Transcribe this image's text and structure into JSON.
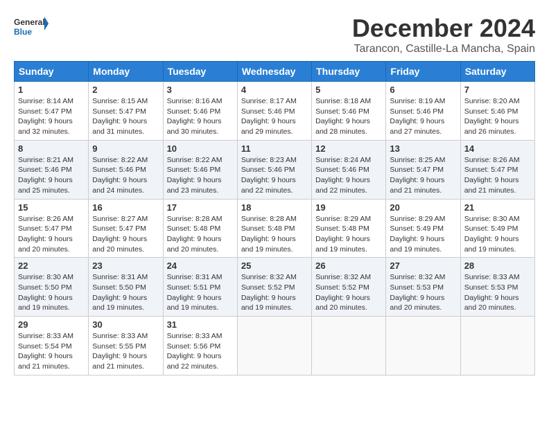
{
  "logo": {
    "general": "General",
    "blue": "Blue"
  },
  "header": {
    "month": "December 2024",
    "location": "Tarancon, Castille-La Mancha, Spain"
  },
  "weekdays": [
    "Sunday",
    "Monday",
    "Tuesday",
    "Wednesday",
    "Thursday",
    "Friday",
    "Saturday"
  ],
  "weeks": [
    [
      {
        "day": "1",
        "info": "Sunrise: 8:14 AM\nSunset: 5:47 PM\nDaylight: 9 hours\nand 32 minutes."
      },
      {
        "day": "2",
        "info": "Sunrise: 8:15 AM\nSunset: 5:47 PM\nDaylight: 9 hours\nand 31 minutes."
      },
      {
        "day": "3",
        "info": "Sunrise: 8:16 AM\nSunset: 5:46 PM\nDaylight: 9 hours\nand 30 minutes."
      },
      {
        "day": "4",
        "info": "Sunrise: 8:17 AM\nSunset: 5:46 PM\nDaylight: 9 hours\nand 29 minutes."
      },
      {
        "day": "5",
        "info": "Sunrise: 8:18 AM\nSunset: 5:46 PM\nDaylight: 9 hours\nand 28 minutes."
      },
      {
        "day": "6",
        "info": "Sunrise: 8:19 AM\nSunset: 5:46 PM\nDaylight: 9 hours\nand 27 minutes."
      },
      {
        "day": "7",
        "info": "Sunrise: 8:20 AM\nSunset: 5:46 PM\nDaylight: 9 hours\nand 26 minutes."
      }
    ],
    [
      {
        "day": "8",
        "info": "Sunrise: 8:21 AM\nSunset: 5:46 PM\nDaylight: 9 hours\nand 25 minutes."
      },
      {
        "day": "9",
        "info": "Sunrise: 8:22 AM\nSunset: 5:46 PM\nDaylight: 9 hours\nand 24 minutes."
      },
      {
        "day": "10",
        "info": "Sunrise: 8:22 AM\nSunset: 5:46 PM\nDaylight: 9 hours\nand 23 minutes."
      },
      {
        "day": "11",
        "info": "Sunrise: 8:23 AM\nSunset: 5:46 PM\nDaylight: 9 hours\nand 22 minutes."
      },
      {
        "day": "12",
        "info": "Sunrise: 8:24 AM\nSunset: 5:46 PM\nDaylight: 9 hours\nand 22 minutes."
      },
      {
        "day": "13",
        "info": "Sunrise: 8:25 AM\nSunset: 5:47 PM\nDaylight: 9 hours\nand 21 minutes."
      },
      {
        "day": "14",
        "info": "Sunrise: 8:26 AM\nSunset: 5:47 PM\nDaylight: 9 hours\nand 21 minutes."
      }
    ],
    [
      {
        "day": "15",
        "info": "Sunrise: 8:26 AM\nSunset: 5:47 PM\nDaylight: 9 hours\nand 20 minutes."
      },
      {
        "day": "16",
        "info": "Sunrise: 8:27 AM\nSunset: 5:47 PM\nDaylight: 9 hours\nand 20 minutes."
      },
      {
        "day": "17",
        "info": "Sunrise: 8:28 AM\nSunset: 5:48 PM\nDaylight: 9 hours\nand 20 minutes."
      },
      {
        "day": "18",
        "info": "Sunrise: 8:28 AM\nSunset: 5:48 PM\nDaylight: 9 hours\nand 19 minutes."
      },
      {
        "day": "19",
        "info": "Sunrise: 8:29 AM\nSunset: 5:48 PM\nDaylight: 9 hours\nand 19 minutes."
      },
      {
        "day": "20",
        "info": "Sunrise: 8:29 AM\nSunset: 5:49 PM\nDaylight: 9 hours\nand 19 minutes."
      },
      {
        "day": "21",
        "info": "Sunrise: 8:30 AM\nSunset: 5:49 PM\nDaylight: 9 hours\nand 19 minutes."
      }
    ],
    [
      {
        "day": "22",
        "info": "Sunrise: 8:30 AM\nSunset: 5:50 PM\nDaylight: 9 hours\nand 19 minutes."
      },
      {
        "day": "23",
        "info": "Sunrise: 8:31 AM\nSunset: 5:50 PM\nDaylight: 9 hours\nand 19 minutes."
      },
      {
        "day": "24",
        "info": "Sunrise: 8:31 AM\nSunset: 5:51 PM\nDaylight: 9 hours\nand 19 minutes."
      },
      {
        "day": "25",
        "info": "Sunrise: 8:32 AM\nSunset: 5:52 PM\nDaylight: 9 hours\nand 19 minutes."
      },
      {
        "day": "26",
        "info": "Sunrise: 8:32 AM\nSunset: 5:52 PM\nDaylight: 9 hours\nand 20 minutes."
      },
      {
        "day": "27",
        "info": "Sunrise: 8:32 AM\nSunset: 5:53 PM\nDaylight: 9 hours\nand 20 minutes."
      },
      {
        "day": "28",
        "info": "Sunrise: 8:33 AM\nSunset: 5:53 PM\nDaylight: 9 hours\nand 20 minutes."
      }
    ],
    [
      {
        "day": "29",
        "info": "Sunrise: 8:33 AM\nSunset: 5:54 PM\nDaylight: 9 hours\nand 21 minutes."
      },
      {
        "day": "30",
        "info": "Sunrise: 8:33 AM\nSunset: 5:55 PM\nDaylight: 9 hours\nand 21 minutes."
      },
      {
        "day": "31",
        "info": "Sunrise: 8:33 AM\nSunset: 5:56 PM\nDaylight: 9 hours\nand 22 minutes."
      },
      {
        "day": "",
        "info": ""
      },
      {
        "day": "",
        "info": ""
      },
      {
        "day": "",
        "info": ""
      },
      {
        "day": "",
        "info": ""
      }
    ]
  ]
}
